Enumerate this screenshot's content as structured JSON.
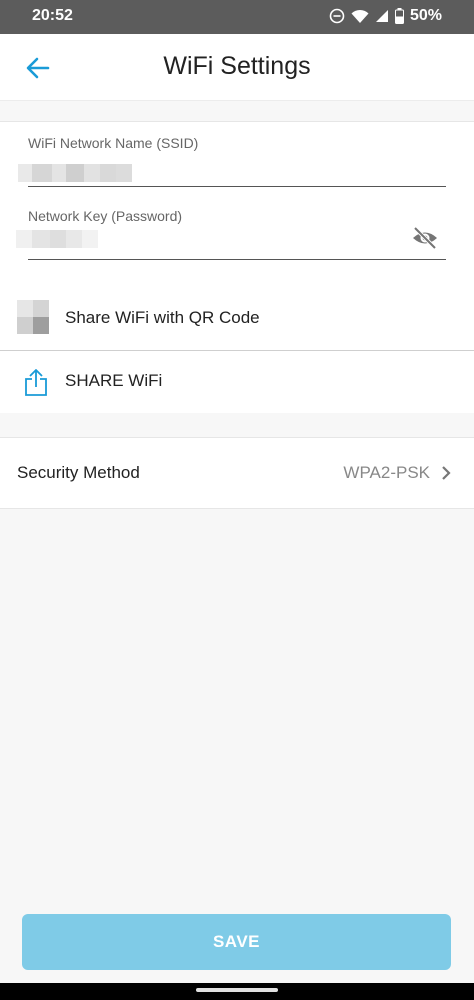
{
  "status_bar": {
    "time": "20:52",
    "battery": "50%"
  },
  "header": {
    "title": "WiFi Settings"
  },
  "form": {
    "ssid_label": "WiFi Network Name (SSID)",
    "password_label": "Network Key (Password)"
  },
  "actions": {
    "qr_label": "Share WiFi with QR Code",
    "share_label": "SHARE WiFi"
  },
  "security": {
    "label": "Security Method",
    "value": "WPA2-PSK"
  },
  "footer": {
    "save_label": "SAVE"
  },
  "colors": {
    "accent": "#1a9bd7",
    "save_button": "#7fcbe7"
  }
}
